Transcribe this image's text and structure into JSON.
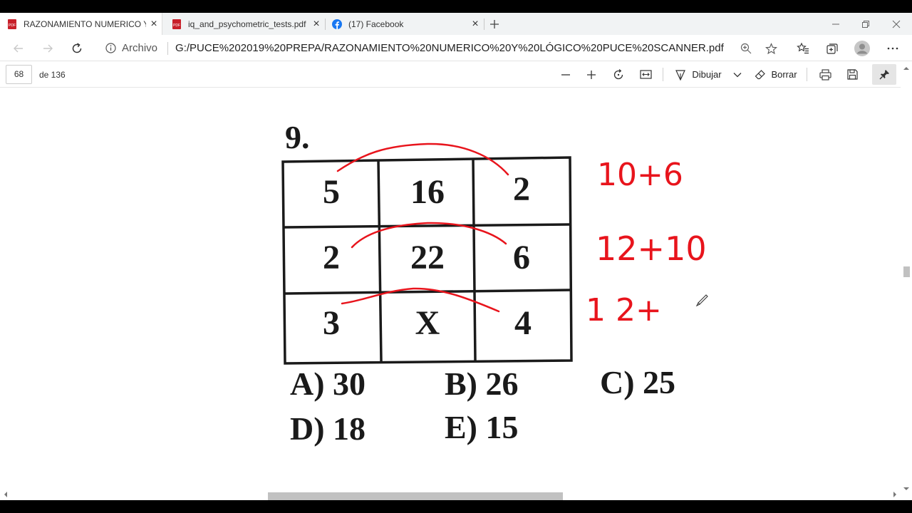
{
  "tabs": [
    {
      "label": "RAZONAMIENTO NUMERICO Y L",
      "icon": "pdf-icon",
      "active": true
    },
    {
      "label": "iq_and_psychometric_tests.pdf",
      "icon": "pdf-icon",
      "active": false
    },
    {
      "label": "(17) Facebook",
      "icon": "facebook-icon",
      "active": false
    }
  ],
  "address": {
    "info_label": "Archivo",
    "url": "G:/PUCE%202019%20PREPA/RAZONAMIENTO%20NUMERICO%20Y%20LÓGICO%20PUCE%20SCANNER.pdf"
  },
  "pdf_toolbar": {
    "page_current": "68",
    "page_total": "de 136",
    "draw_label": "Dibujar",
    "erase_label": "Borrar"
  },
  "problem": {
    "number": "9.",
    "grid": [
      [
        "5",
        "16",
        "2"
      ],
      [
        "2",
        "22",
        "6"
      ],
      [
        "3",
        "X",
        "4"
      ]
    ],
    "answers": [
      {
        "text": "A) 30"
      },
      {
        "text": "B) 26"
      },
      {
        "text": "C) 25"
      },
      {
        "text": "D) 18"
      },
      {
        "text": "E) 15"
      }
    ]
  },
  "annotations": {
    "line1": "10+6",
    "line2": "12+10",
    "line3": "1 2+",
    "ink_color": "#e8141c"
  },
  "colors": {
    "tab_strip": "#f1f3f4",
    "facebook": "#1877f2",
    "pdf_red": "#c8202a"
  }
}
